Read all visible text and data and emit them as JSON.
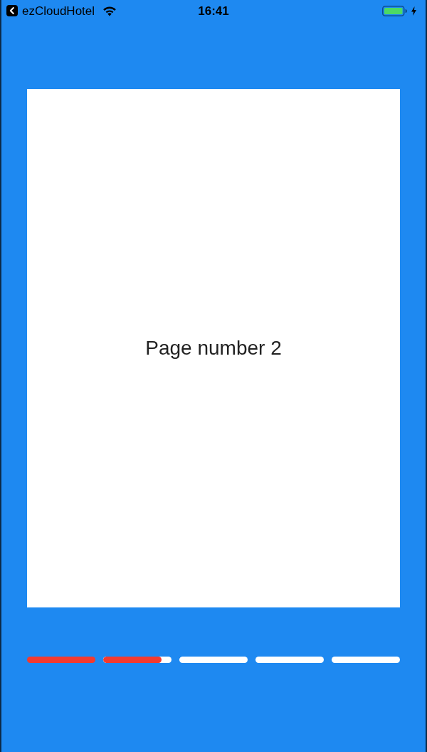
{
  "status_bar": {
    "back_app": "ezCloudHotel",
    "time": "16:41",
    "charging": true
  },
  "page": {
    "text": "Page number 2"
  },
  "indicators": [
    {
      "kind": "complete"
    },
    {
      "kind": "partial",
      "level": 0.85
    },
    {
      "kind": "empty"
    },
    {
      "kind": "empty"
    },
    {
      "kind": "empty"
    }
  ]
}
